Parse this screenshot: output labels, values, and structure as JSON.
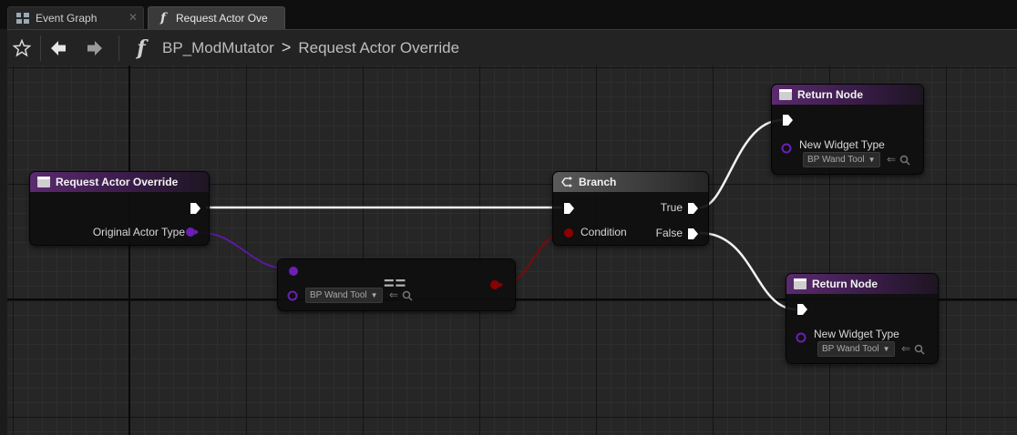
{
  "tabs": [
    {
      "label": "Event Graph",
      "active": false
    },
    {
      "label": "Request Actor Ove",
      "active": true
    }
  ],
  "breadcrumb": {
    "blueprint": "BP_ModMutator",
    "function": "Request Actor Override"
  },
  "toolbar": {
    "function_glyph": "f",
    "chevron": ">"
  },
  "nodes": {
    "entry": {
      "title": "Request Actor Override",
      "pin_original": "Original Actor Type"
    },
    "compare": {
      "combo": "BP Wand Tool",
      "symbol": "=="
    },
    "branch": {
      "title": "Branch",
      "pin_true": "True",
      "pin_false": "False",
      "pin_condition": "Condition"
    },
    "return_top": {
      "title": "Return Node",
      "pin_label": "New Widget Type",
      "combo": "BP Wand Tool"
    },
    "return_bottom": {
      "title": "Return Node",
      "pin_label": "New Widget Type",
      "combo": "BP Wand Tool"
    }
  },
  "colors": {
    "exec": "#ffffff",
    "class_pin": "#6b1fb8",
    "bool_pin": "#8b0000",
    "header_purple": "#5a2a6e"
  }
}
